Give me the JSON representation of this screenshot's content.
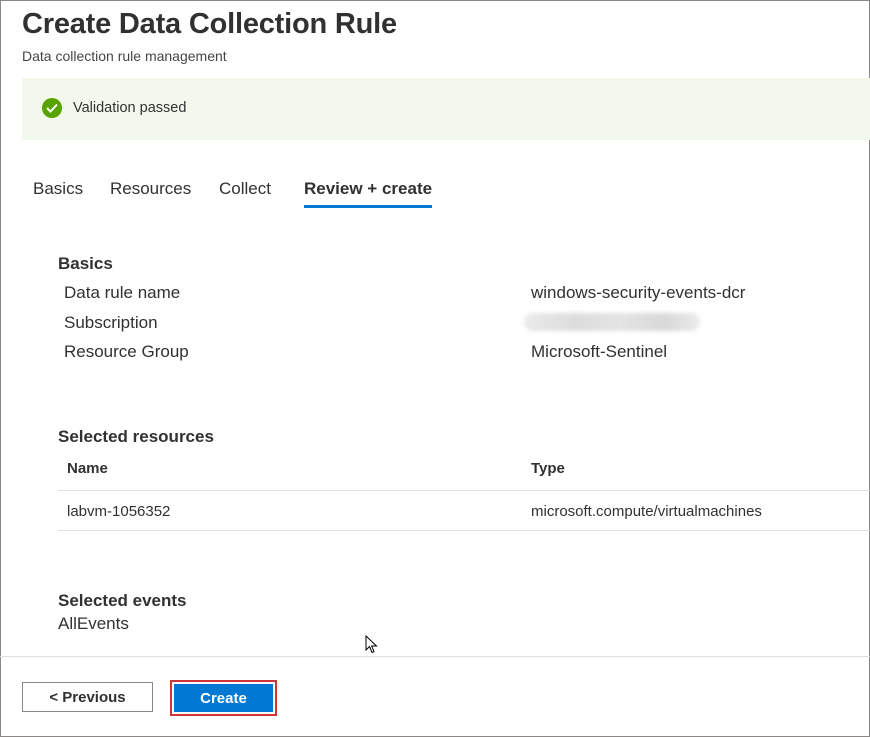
{
  "header": {
    "title": "Create Data Collection Rule",
    "subtitle": "Data collection rule management"
  },
  "banner": {
    "message": "Validation passed",
    "icon": "check-circle-icon",
    "color": "#57a300"
  },
  "tabs": [
    {
      "label": "Basics",
      "active": false
    },
    {
      "label": "Resources",
      "active": false
    },
    {
      "label": "Collect",
      "active": false
    },
    {
      "label": "Review + create",
      "active": true
    }
  ],
  "basics": {
    "title": "Basics",
    "rows": [
      {
        "label": "Data rule name",
        "value": "windows-security-events-dcr"
      },
      {
        "label": "Subscription",
        "value": ""
      },
      {
        "label": "Resource Group",
        "value": "Microsoft-Sentinel"
      }
    ]
  },
  "resources": {
    "title": "Selected resources",
    "columns": [
      "Name",
      "Type"
    ],
    "rows": [
      {
        "name": "labvm-1056352",
        "type": "microsoft.compute/virtualmachines"
      }
    ]
  },
  "events": {
    "title": "Selected events",
    "value": "AllEvents"
  },
  "footer": {
    "previous_label": "< Previous",
    "create_label": "Create"
  },
  "colors": {
    "accent": "#0078d4",
    "highlight": "#d13438",
    "banner_bg": "#f2f9ec"
  }
}
